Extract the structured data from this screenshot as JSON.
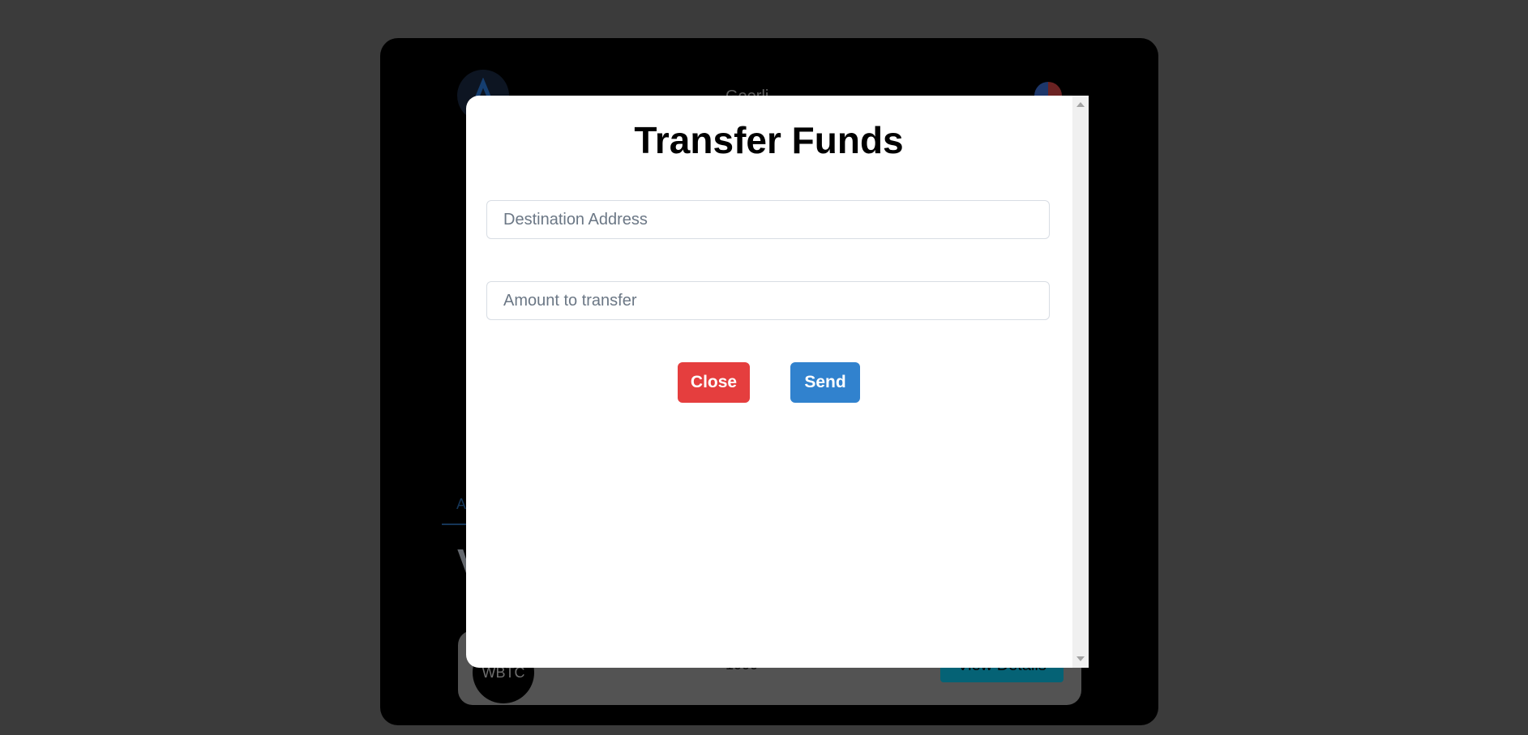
{
  "background": {
    "network_label": "Goerli",
    "tab_label": "A",
    "heading_letter": "V",
    "token": {
      "symbol": "WBTC",
      "amount": "1000",
      "details_label": "View Details"
    }
  },
  "modal": {
    "title": "Transfer Funds",
    "destination_placeholder": "Destination Address",
    "amount_placeholder": "Amount to transfer",
    "close_label": "Close",
    "send_label": "Send"
  },
  "colors": {
    "close_button": "#e53e3e",
    "send_button": "#3182ce",
    "overlay": "#777777"
  }
}
